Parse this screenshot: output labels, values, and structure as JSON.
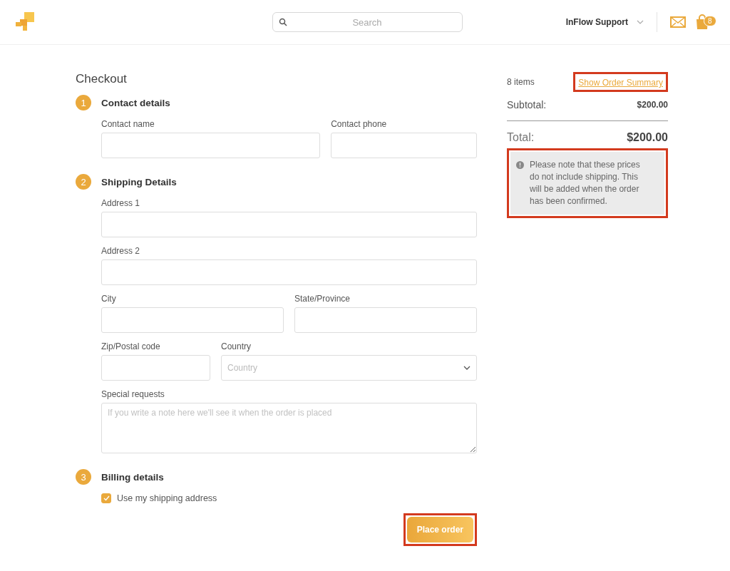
{
  "header": {
    "search": {
      "placeholder": "Search"
    },
    "user": "InFlow Support",
    "cart_count": "8"
  },
  "checkout": {
    "title": "Checkout",
    "sections": [
      {
        "number": "1",
        "title": "Contact details",
        "rows": [
          [
            {
              "kind": "text",
              "label": "Contact name"
            },
            {
              "kind": "text",
              "label": "Contact phone"
            }
          ]
        ]
      },
      {
        "number": "2",
        "title": "Shipping Details",
        "rows": [
          [
            {
              "kind": "text",
              "label": "Address 1"
            }
          ],
          [
            {
              "kind": "text",
              "label": "Address 2"
            }
          ],
          [
            {
              "kind": "text",
              "label": "City"
            },
            {
              "kind": "text",
              "label": "State/Province"
            }
          ],
          [
            {
              "kind": "text",
              "label": "Zip/Postal code"
            },
            {
              "kind": "select",
              "label": "Country",
              "placeholder": "Country"
            }
          ],
          [
            {
              "kind": "textarea",
              "label": "Special requests",
              "placeholder": "If you write a note here we'll see it when the order is placed"
            }
          ]
        ]
      },
      {
        "number": "3",
        "title": "Billing details",
        "checkbox": {
          "label": "Use my shipping address",
          "checked": true
        }
      }
    ],
    "place_order": {
      "label": "Place order",
      "highlighted": true
    }
  },
  "summary": {
    "items": "8 items",
    "link": {
      "label": "Show Order Summary",
      "highlighted": true
    },
    "subtotal_label": "Subtotal:",
    "subtotal": "$200.00",
    "total_label": "Total:",
    "total": "$200.00",
    "notice": {
      "text": "Please note that these prices do not include shipping. This will be added when the order has been confirmed.",
      "highlighted": true
    }
  }
}
